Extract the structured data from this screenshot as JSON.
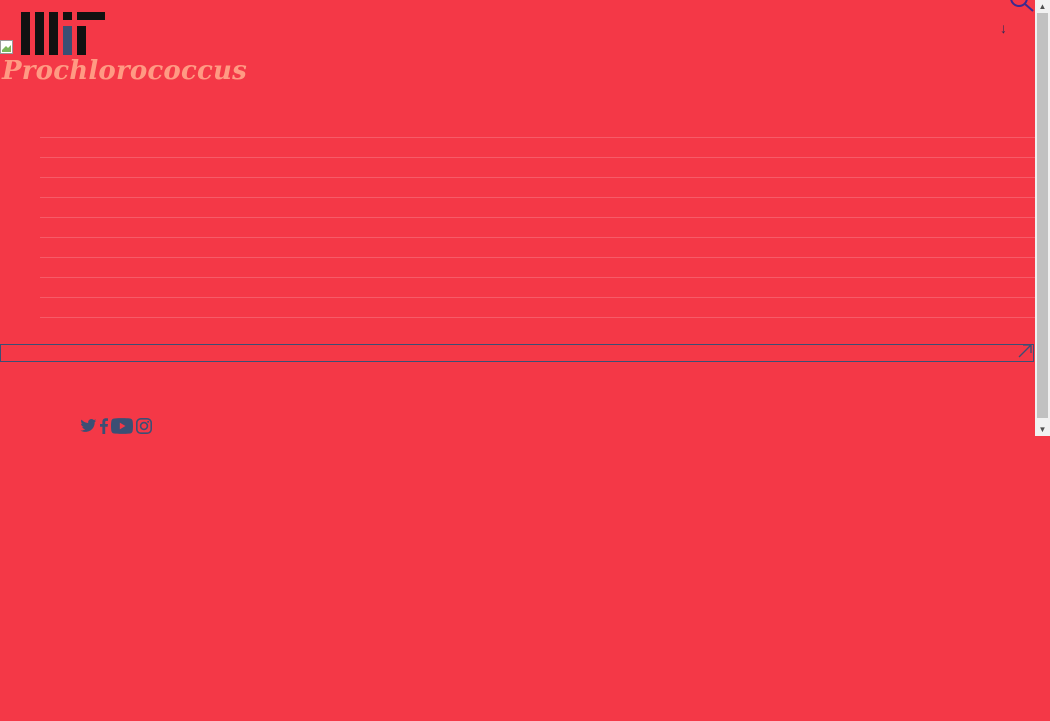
{
  "site": {
    "logo_name": "MIT",
    "title": "Prochlorococcus"
  },
  "header": {
    "search_icon": "search-icon",
    "down_arrow": "↓"
  },
  "menu": {
    "items": [
      "",
      "",
      "",
      "",
      "",
      "",
      "",
      "",
      "",
      "",
      ""
    ]
  },
  "link_bar": {
    "label": "",
    "icon": "external-arrow-icon"
  },
  "social": {
    "icons": [
      "twitter-icon",
      "facebook-icon",
      "youtube-icon",
      "instagram-icon"
    ]
  },
  "scrollbar": {
    "up": "▲",
    "down": "▼"
  },
  "colors": {
    "background": "#f43847",
    "title": "#ff9a83",
    "dark": "#1f1f2e",
    "icon": "#3b4f74"
  }
}
